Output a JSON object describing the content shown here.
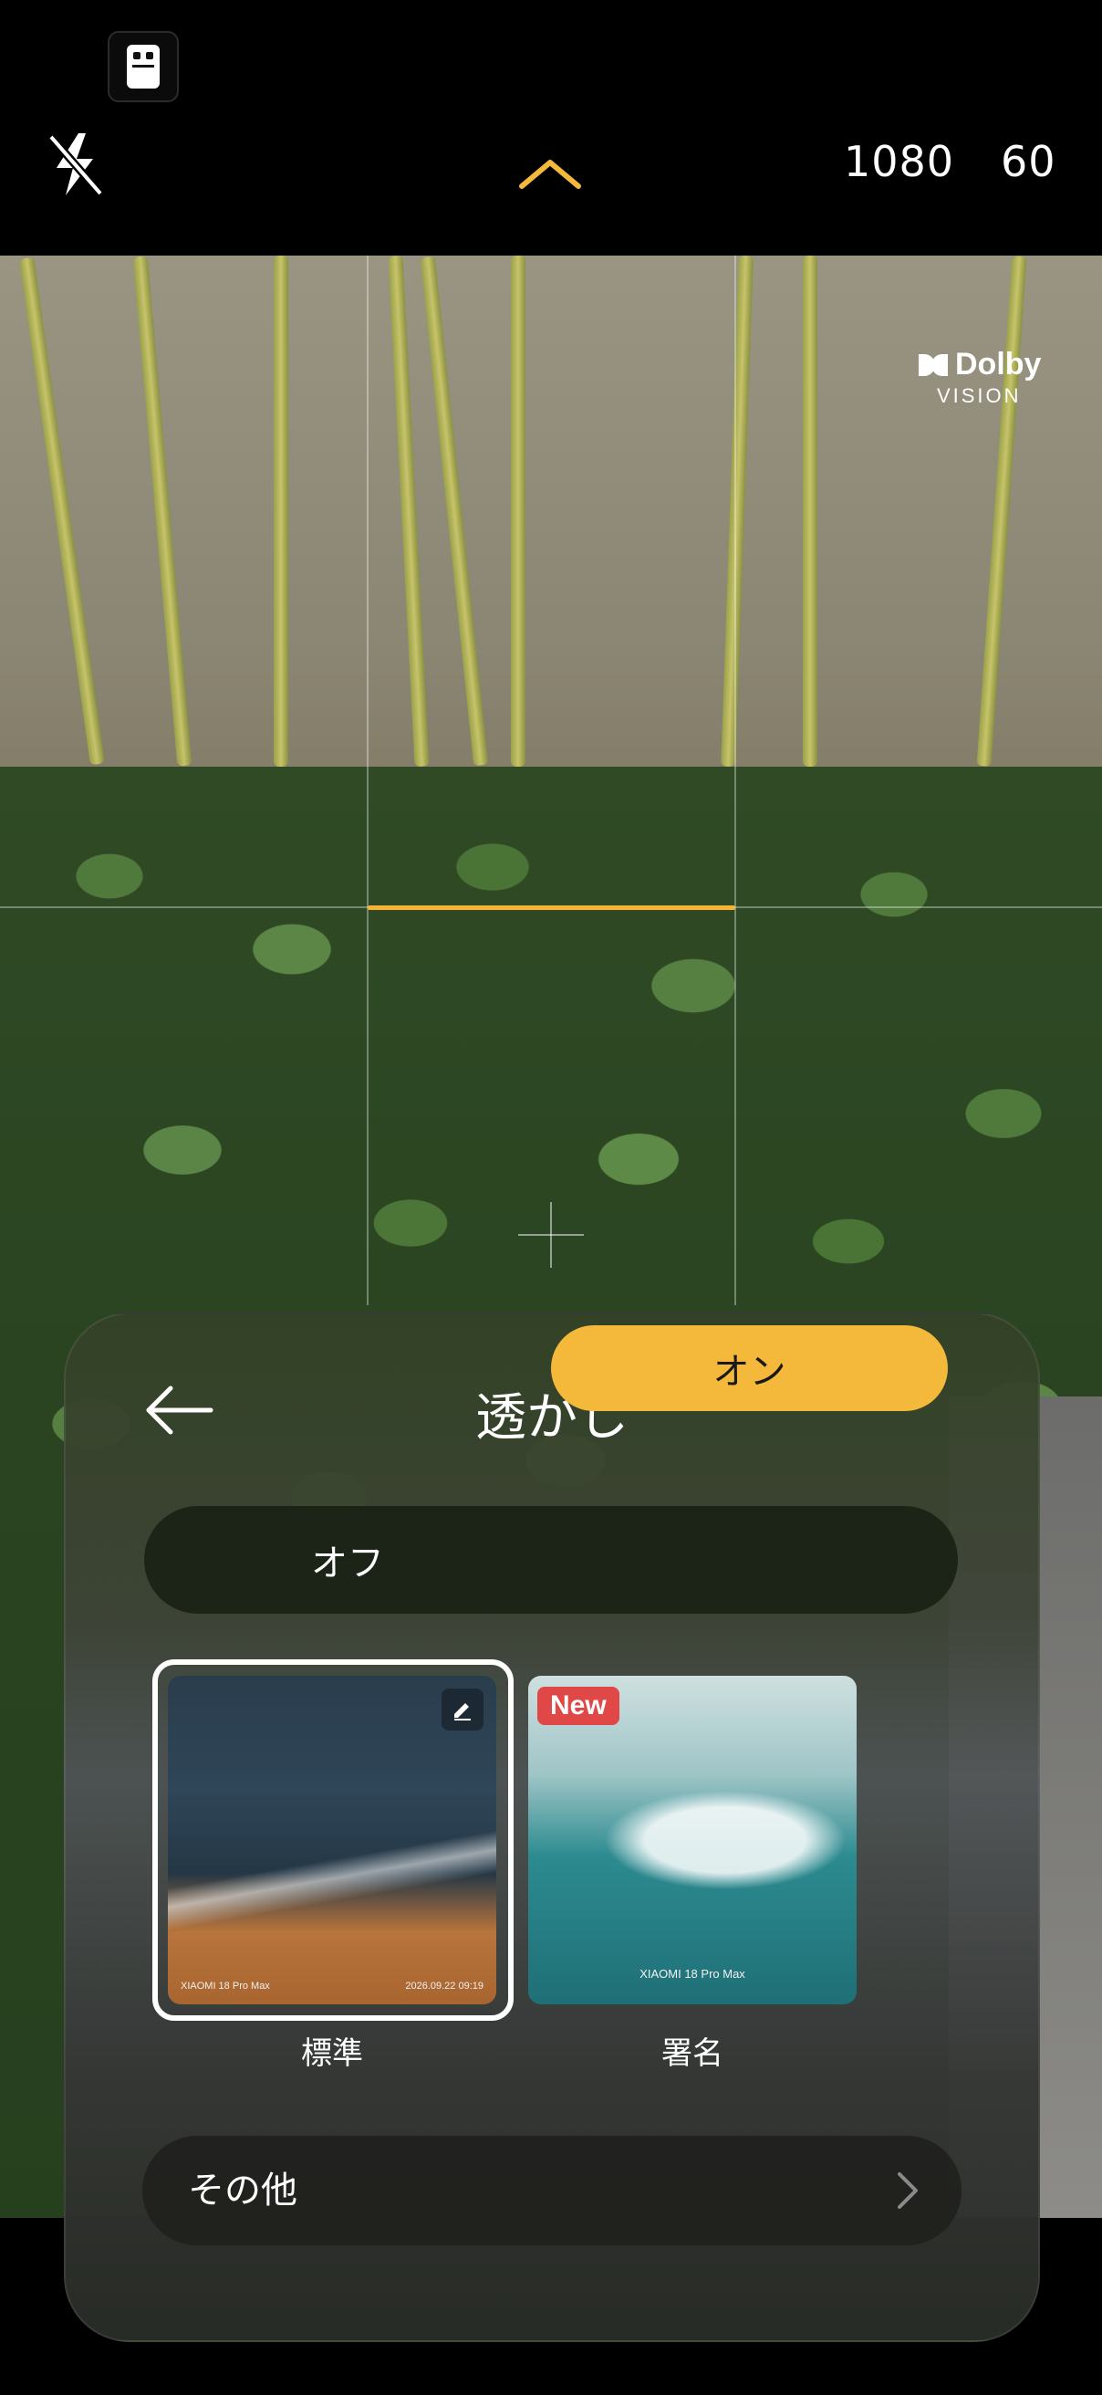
{
  "topbar": {
    "resolution": "1080",
    "fps": "60"
  },
  "viewfinder": {
    "dolby_brand": "Dolby",
    "dolby_sub": "VISION"
  },
  "watermark_panel": {
    "title": "透かし",
    "toggle": {
      "off_label": "オフ",
      "on_label": "オン",
      "selected": "on"
    },
    "styles": [
      {
        "label": "標準",
        "selected": true,
        "watermark_left": "XIAOMI 18 Pro Max",
        "watermark_right": "2026.09.22 09:19"
      },
      {
        "label": "署名",
        "selected": false,
        "badge": "New",
        "watermark_brand": "XIAOMI 18 Pro Max"
      }
    ],
    "more_label": "その他"
  },
  "colors": {
    "accent": "#f4b93b",
    "new_badge": "#e04848"
  },
  "icons": [
    "mode-switch-icon",
    "flash-off-icon",
    "chevron-up-icon",
    "back-arrow-icon",
    "edit-icon",
    "chevron-right-icon"
  ]
}
